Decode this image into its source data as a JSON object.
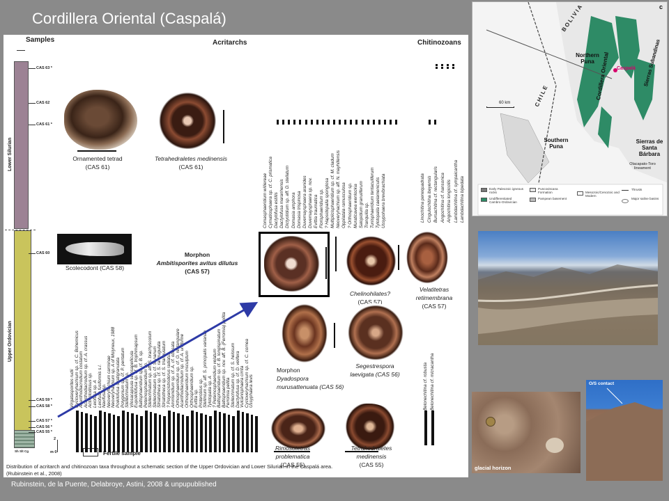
{
  "slide": {
    "title": "Cordillera Oriental (Caspalá)",
    "credit": "Rubinstein,  de la Puente, Delabroye, Astini, 2008 & unpupublished"
  },
  "panel": {
    "headers": {
      "samples": "Samples",
      "acritarchs": "Acritarchs",
      "chitinozoans": "Chitinozoans"
    },
    "units": {
      "lower_silurian": "Lower Silurian",
      "upper_ordovician": "Upper Ordovician"
    },
    "samples": [
      "CAS 63",
      "CAS 62",
      "CAS 61",
      "CAS 60",
      "CAS 59",
      "CAS 58",
      "CAS 57",
      "CAS 56",
      "CAS 55"
    ],
    "scale": {
      "top": "2",
      "bottom": "m 0",
      "grain": "Sh Slt Cg"
    },
    "legend": "Fertile sample",
    "caption_line1": "Distribution of acritarch and chitinozoan taxa throughout a schematic section of the Upper Ordovician and Lower Silurian in the Caspalá area.",
    "caption_line2": "(Rubinstein et al., 2008)",
    "images": {
      "ornamented": {
        "name": "Ornamented tetrad",
        "sample": "(CAS 61)"
      },
      "tetrahedraletes_top": {
        "name": "Tetrahedraletes medinensis",
        "sample": "(CAS 61)"
      },
      "scolecodont": {
        "name": "Scolecodont (CAS 58)"
      },
      "morphon_title": {
        "line1": "Morphon",
        "line2": "Ambitisporites avitus dilutus",
        "line3": "(CAS 57)"
      },
      "chelinohilates": {
        "name": "Chelinohilates?",
        "sample": "(CAS 57)"
      },
      "velatitetras": {
        "line1": "Velatitetras",
        "line2": "retimembrana",
        "sample": "(CAS 57)"
      },
      "dyadospora": {
        "line1": "Morphon",
        "line2": "Dyadospora",
        "line3": "murusattenuata (CAS 56)"
      },
      "segestrespora": {
        "line1": "Segestrespora",
        "line2": "laevigata (CAS 56)"
      },
      "rimosotetras": {
        "line1": "Rimosotetras",
        "line2": "problematica",
        "sample": "(CAS 55)"
      },
      "tetrahedraletes_bottom": {
        "line1": "Tetrahedraletes",
        "line2": "medinensis",
        "sample": "(CAS 55)"
      }
    },
    "taxa_silurian": [
      "Comasphaeridium williereae",
      "Cymatiosphaera sp. cf. C. prismatica",
      "Dactylofusa estillis",
      "Dactylofusa maranhensis",
      "Dictyotidium sp. aff. D. stellatum",
      "Domasia amphora",
      "Domasia trispinosa",
      "Duvernaysphaera aranides",
      "Duvernaysphaera sp. nov.",
      "Evittia traumatica",
      "Florisphaeridium sp.",
      "? Hapsidopalla sponglosa",
      "Multiplicisphaeridium sp. cf. M. cladum",
      "Neoveryhachium sp. aff. N. mayhillensis",
      "Oppilatala ramusculosa",
      "? Orthosphaeridium sp.",
      "Muraticavea wenlockia",
      "Salopidium granuliferum",
      "Tranquilla sp.",
      "Tunisphaeridium tentaculiferum",
      "Tylotopalla caelamenicutis",
      "Ussypohaera brevibrachiata"
    ],
    "taxa_chitinozoa_sil": [
      "Linochitina penequadrata",
      "Cingulochitina ibeyensis",
      "Bursachitina cf. rectangularis",
      "Angochitina cf. hansonica",
      "Angochitina longicollis",
      "Lambdachitina cf. sympaicantha",
      "Lambdachitina bipedata"
    ],
    "taxa_ordovician": [
      "Virgatasporites rudii",
      "Cycloveryhachium sp. cf. C. Bohemicus",
      "Acanthodiacrodium costatum",
      "Acanthodiacrodium sp. cf. A. crassus",
      "Actinotodissus sp.",
      "Leiofusa sp. A",
      "Leiofusa fusiformis s.l.",
      "Navifusa sp.",
      "Neoveryhachium carminae",
      "Neoveryhachium sp. A of Molyneux, 1988",
      "Poikilofusa stratigranulata",
      "Polygonium sp. cf. P. pentatum",
      "Stellechinatum sp.",
      "Vilosacapsula setosapellicula",
      "Eupoikilofusa sp. cf. B. trophimapsum",
      "Baltisphaeridium sp. cf. B. sp.",
      "Peteinosphaeridium sp.",
      "Stellechinatum sp. aff. S. brachyscolum",
      "Stellechinatum sp. cf. S. nanum",
      "Striatotheca sp. cf. S. rarirrugulata",
      "Striatotheca sp. cf. S. triangulatum",
      "? Polyancistrodorus radiatus",
      "Ammonidium sp. cf. A. cf. obesata",
      "Orthosphaeridium sp. cf. O. rectangulare",
      "Acanthodiacrodium sp. cf. A. uniforme",
      "Orthosphaeridium insculptum",
      "Orthosphaeridium sp.",
      "Evittia sp.",
      "Proteroblus sp.",
      "Stellinium sp. aff. S. principalis varianae",
      "Tylotopalla sp. A",
      "? Peteinosphaeridium velatum",
      "Baltisphaeridium sp. cf. B. longispinatum",
      "Baltisphaeridium sp. nov. aff. B. (Ferromia) pellita",
      "Ferromia pellita",
      "Stellechinatum sp. cf. S. helosum",
      "Dactylofusa sp. cf. D. velifera",
      "Vulcanisphaera cirrita",
      "Cycloveryhachium sp. cf. C. cornea",
      "Ussyphaera levis"
    ],
    "taxa_chitinozoa_ord": [
      "Belonechitina cf. robusta",
      "Belonechitina cf. micracantha"
    ]
  },
  "map": {
    "labels": {
      "bolivia": "BOLIVIA",
      "chile": "CHILE",
      "northern_puna": "Northern Puna",
      "cordillera_oriental": "Cordillera Oriental",
      "sierras_subandinas": "Sierras Subandinas",
      "caspala": "Caspalá",
      "southern_puna": "Southern Puna",
      "santa_barbara": "Sierras de Santa Bárbara",
      "olacapato": "Olacapato-Toro lineament",
      "scale": "60 km",
      "panel_letter": "c"
    },
    "legend": [
      "Early Paleozoic igneous rocks",
      "Undifferentiated Cambro-Ordovician",
      "Puncoviscana Formation",
      "Pampean basement",
      "Mesozoic/Cenozoic and Modern",
      "Thrusts",
      "Major saline basins"
    ],
    "colors": {
      "green": "#2e8b66",
      "magenta": "#d6006b"
    }
  },
  "photos": {
    "os_contact": "O/S contact",
    "glacial_horizon": "glacial horizon"
  },
  "colors": {
    "silurian_column": "#9c8294",
    "ordovician_column": "#c9c45c",
    "arrow": "#2d3aa6",
    "highlight_box": "#000000"
  }
}
